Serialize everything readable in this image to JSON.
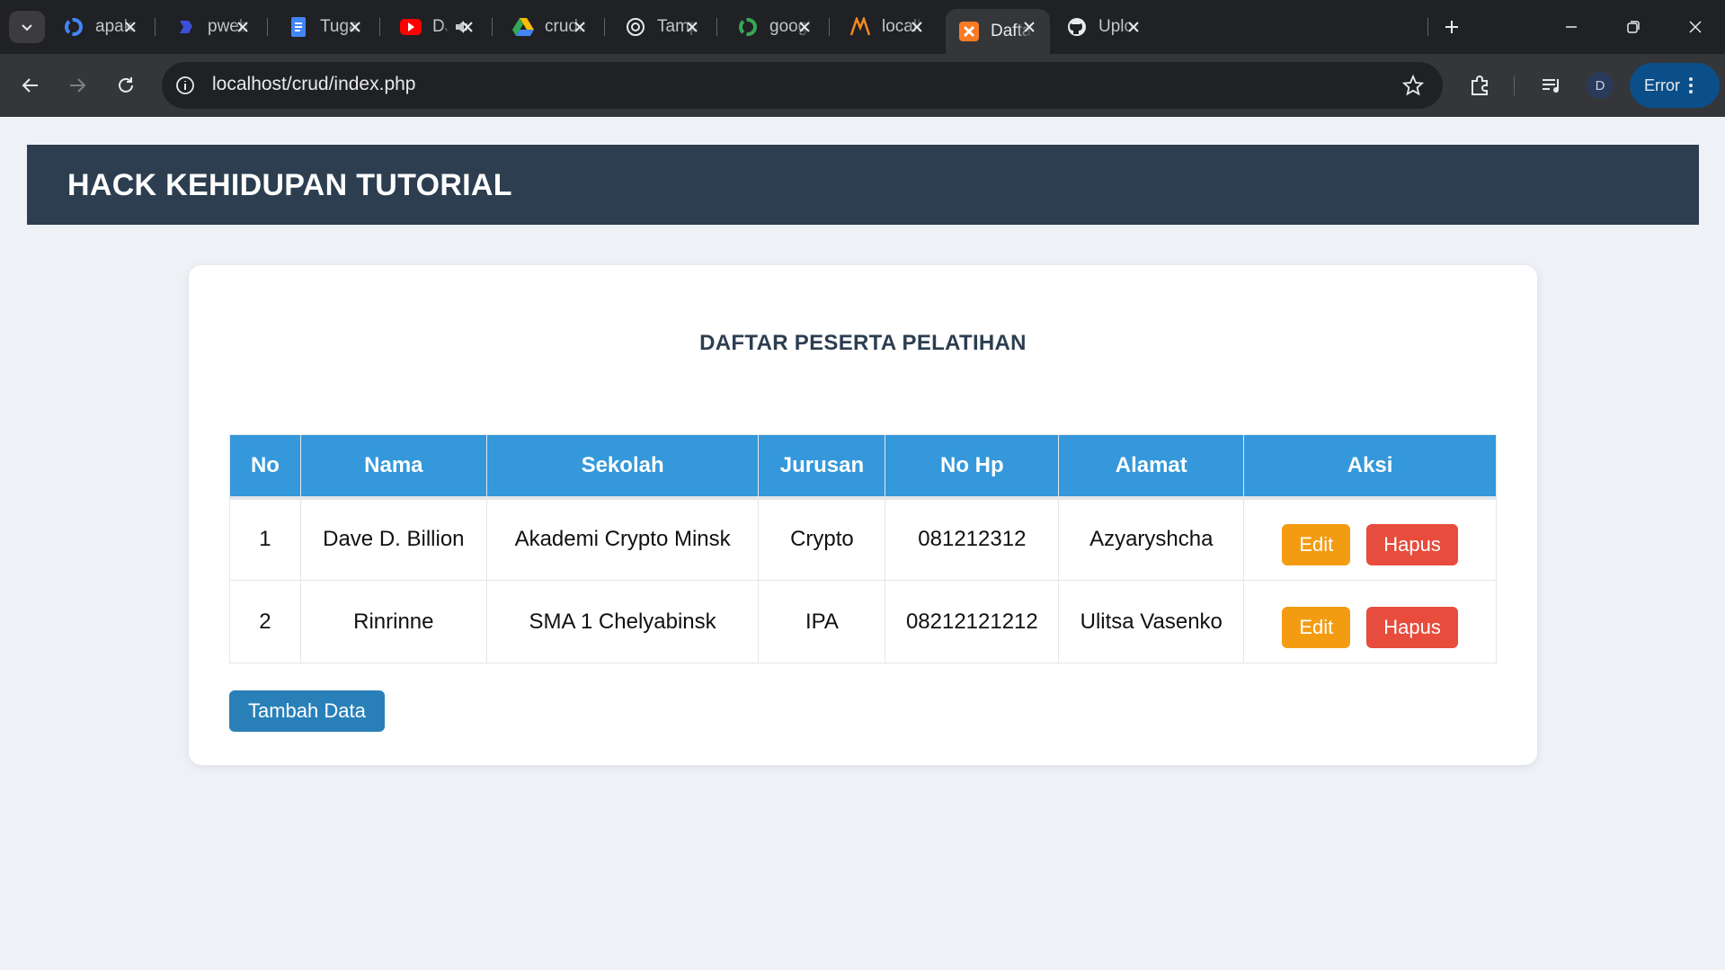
{
  "browser": {
    "tabs": [
      {
        "label": "apaka",
        "icon": "google-icon"
      },
      {
        "label": "pweb",
        "icon": "pweb-icon"
      },
      {
        "label": "Tugas",
        "icon": "docs-icon"
      },
      {
        "label": "DJ",
        "icon": "youtube-icon"
      },
      {
        "label": "crud.r",
        "icon": "drive-icon"
      },
      {
        "label": "Tampi",
        "icon": "chatgpt-icon"
      },
      {
        "label": "googl",
        "icon": "google-icon"
      },
      {
        "label": "localh",
        "icon": "xampp-icon"
      },
      {
        "label": "Daftar",
        "icon": "xampp-icon"
      },
      {
        "label": "Uploa",
        "icon": "github-icon"
      }
    ],
    "url": "localhost/crud/index.php",
    "profile_initial": "D",
    "error_label": "Error",
    "colors": {
      "chrome_dark": "#202124",
      "toolbar": "#35363a",
      "error_chip": "#0b4f8a"
    }
  },
  "site": {
    "title": "HACK KEHIDUPAN TUTORIAL",
    "colors": {
      "header": "#2c3e50",
      "table_head": "#3498db",
      "edit": "#f39c12",
      "delete": "#e74c3c",
      "add": "#2980b9"
    }
  },
  "main": {
    "heading": "DAFTAR PESERTA PELATIHAN",
    "table": {
      "columns": [
        "No",
        "Nama",
        "Sekolah",
        "Jurusan",
        "No Hp",
        "Alamat",
        "Aksi"
      ],
      "rows": [
        {
          "no": "1",
          "nama": "Dave D. Billion",
          "sekolah": "Akademi Crypto Minsk",
          "jurusan": "Crypto",
          "no_hp": "081212312",
          "alamat": "Azyaryshcha"
        },
        {
          "no": "2",
          "nama": "Rinrinne",
          "sekolah": "SMA 1 Chelyabinsk",
          "jurusan": "IPA",
          "no_hp": "08212121212",
          "alamat": "Ulitsa Vasenko"
        }
      ],
      "edit_label": "Edit",
      "delete_label": "Hapus"
    },
    "add_label": "Tambah Data"
  }
}
